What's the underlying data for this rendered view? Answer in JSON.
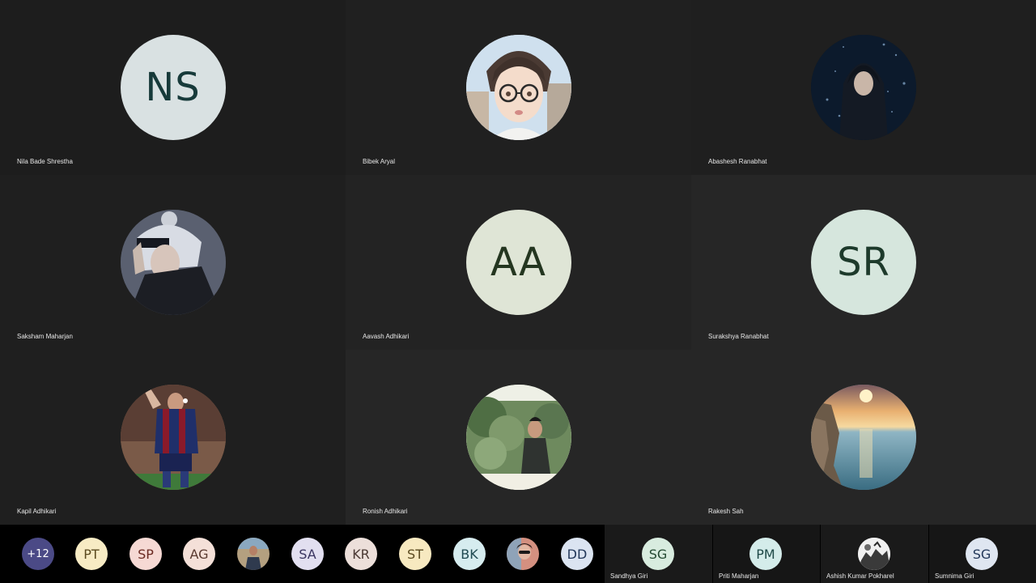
{
  "participants": [
    {
      "name": "Nila Bade Shrestha",
      "initials": "NS",
      "bg": "#d9e1e2",
      "fg": "#173a3a",
      "photo": null
    },
    {
      "name": "Bibek Aryal",
      "initials": "",
      "bg": "#e8e4e0",
      "photo": "anime-boy-glasses"
    },
    {
      "name": "Abashesh Ranabhat",
      "initials": "",
      "bg": "#0b1624",
      "photo": "hooded-figure"
    },
    {
      "name": "Saksham Maharjan",
      "initials": "",
      "bg": "#3a3e4a",
      "photo": "anime-dark-hair"
    },
    {
      "name": "Aavash Adhikari",
      "initials": "AA",
      "bg": "#dfe5d6",
      "fg": "#243620",
      "photo": null
    },
    {
      "name": "Surakshya Ranabhat",
      "initials": "SR",
      "bg": "#d6e6dd",
      "fg": "#1d3a2b",
      "photo": null
    },
    {
      "name": "Kapil Adhikari",
      "initials": "",
      "bg": "#6b4a3a",
      "photo": "footballer"
    },
    {
      "name": "Ronish Adhikari",
      "initials": "",
      "bg": "#9fb494",
      "photo": "man-in-forest"
    },
    {
      "name": "Rakesh Sah",
      "initials": "",
      "bg": "#6a8a9a",
      "photo": "sunset-sea"
    }
  ],
  "strip": {
    "overflow_label": "+12",
    "items": [
      {
        "initials": "PT",
        "bg": "#f7ebc4",
        "fg": "#5a4a1f"
      },
      {
        "initials": "SP",
        "bg": "#f6d9d4",
        "fg": "#6b2a22"
      },
      {
        "initials": "AG",
        "bg": "#f4e0d8",
        "fg": "#5a3a30"
      },
      {
        "initials": "",
        "bg": "#b49070",
        "photo": "person-photo"
      },
      {
        "initials": "SA",
        "bg": "#e2dff0",
        "fg": "#3a3560"
      },
      {
        "initials": "KR",
        "bg": "#ecdfda",
        "fg": "#4a3833"
      },
      {
        "initials": "ST",
        "bg": "#f7e9c0",
        "fg": "#5a4a1f"
      },
      {
        "initials": "BK",
        "bg": "#d6ecef",
        "fg": "#1f4a52"
      },
      {
        "initials": "",
        "bg": "#c07a6a",
        "photo": "person-photo-2"
      },
      {
        "initials": "DD",
        "bg": "#dbe4f1",
        "fg": "#23385a"
      }
    ],
    "side": [
      {
        "name": "Sandhya Giri",
        "initials": "SG",
        "bg": "#d8ecdf",
        "fg": "#244a32"
      },
      {
        "name": "Priti Maharjan",
        "initials": "PM",
        "bg": "#d4ecea",
        "fg": "#1f4a48"
      },
      {
        "name": "Ashish Kumar Pokharel",
        "initials": "",
        "bg": "#e8e8e8",
        "photo": "bw-photo"
      },
      {
        "name": "Sumnima Giri",
        "initials": "SG",
        "bg": "#dfe6f1",
        "fg": "#23385a"
      }
    ]
  }
}
